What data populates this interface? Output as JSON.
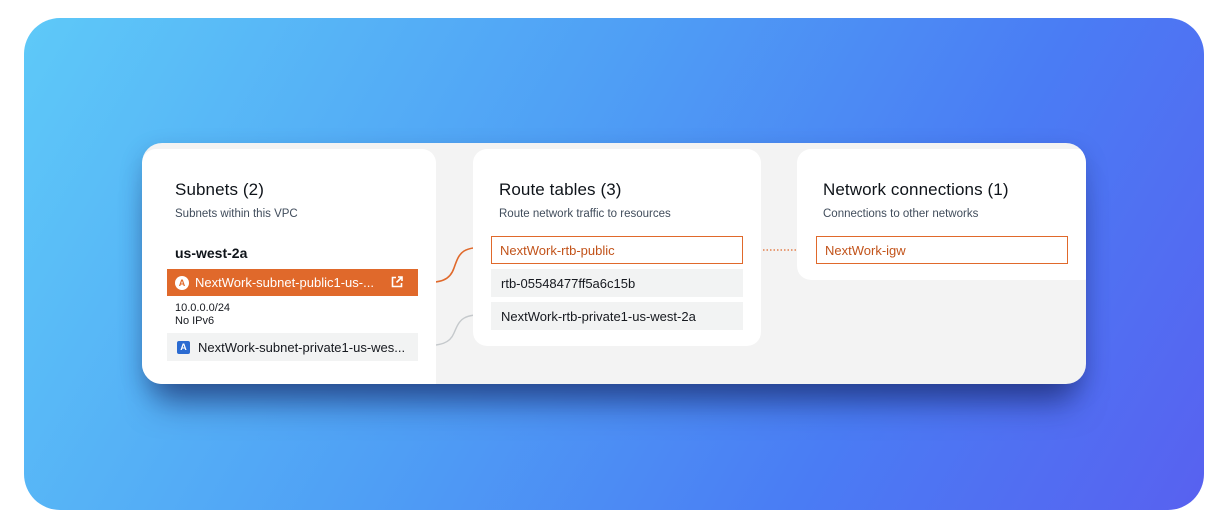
{
  "subnets": {
    "title": "Subnets (2)",
    "subtitle": "Subnets within this VPC",
    "az": "us-west-2a",
    "items": [
      {
        "badge": "A",
        "label": "NextWork-subnet-public1-us-...",
        "cidr": "10.0.0.0/24",
        "ipv6": "No IPv6",
        "selected": true
      },
      {
        "badge": "A",
        "label": "NextWork-subnet-private1-us-wes..."
      }
    ]
  },
  "route_tables": {
    "title": "Route tables (3)",
    "subtitle": "Route network traffic to resources",
    "items": [
      {
        "label": "NextWork-rtb-public",
        "highlighted": true
      },
      {
        "label": "rtb-05548477ff5a6c15b"
      },
      {
        "label": "NextWork-rtb-private1-us-west-2a"
      }
    ]
  },
  "network_connections": {
    "title": "Network connections (1)",
    "subtitle": "Connections to other networks",
    "items": [
      {
        "label": "NextWork-igw",
        "highlighted": true
      }
    ]
  },
  "colors": {
    "accent": "#e0692b",
    "link_inactive": "#c5c9cc",
    "background_gradient": [
      "#5ec9f8",
      "#4a7cf4",
      "#5861f0"
    ]
  },
  "icons": [
    "external-link-icon",
    "availability-zone-badge-icon"
  ]
}
